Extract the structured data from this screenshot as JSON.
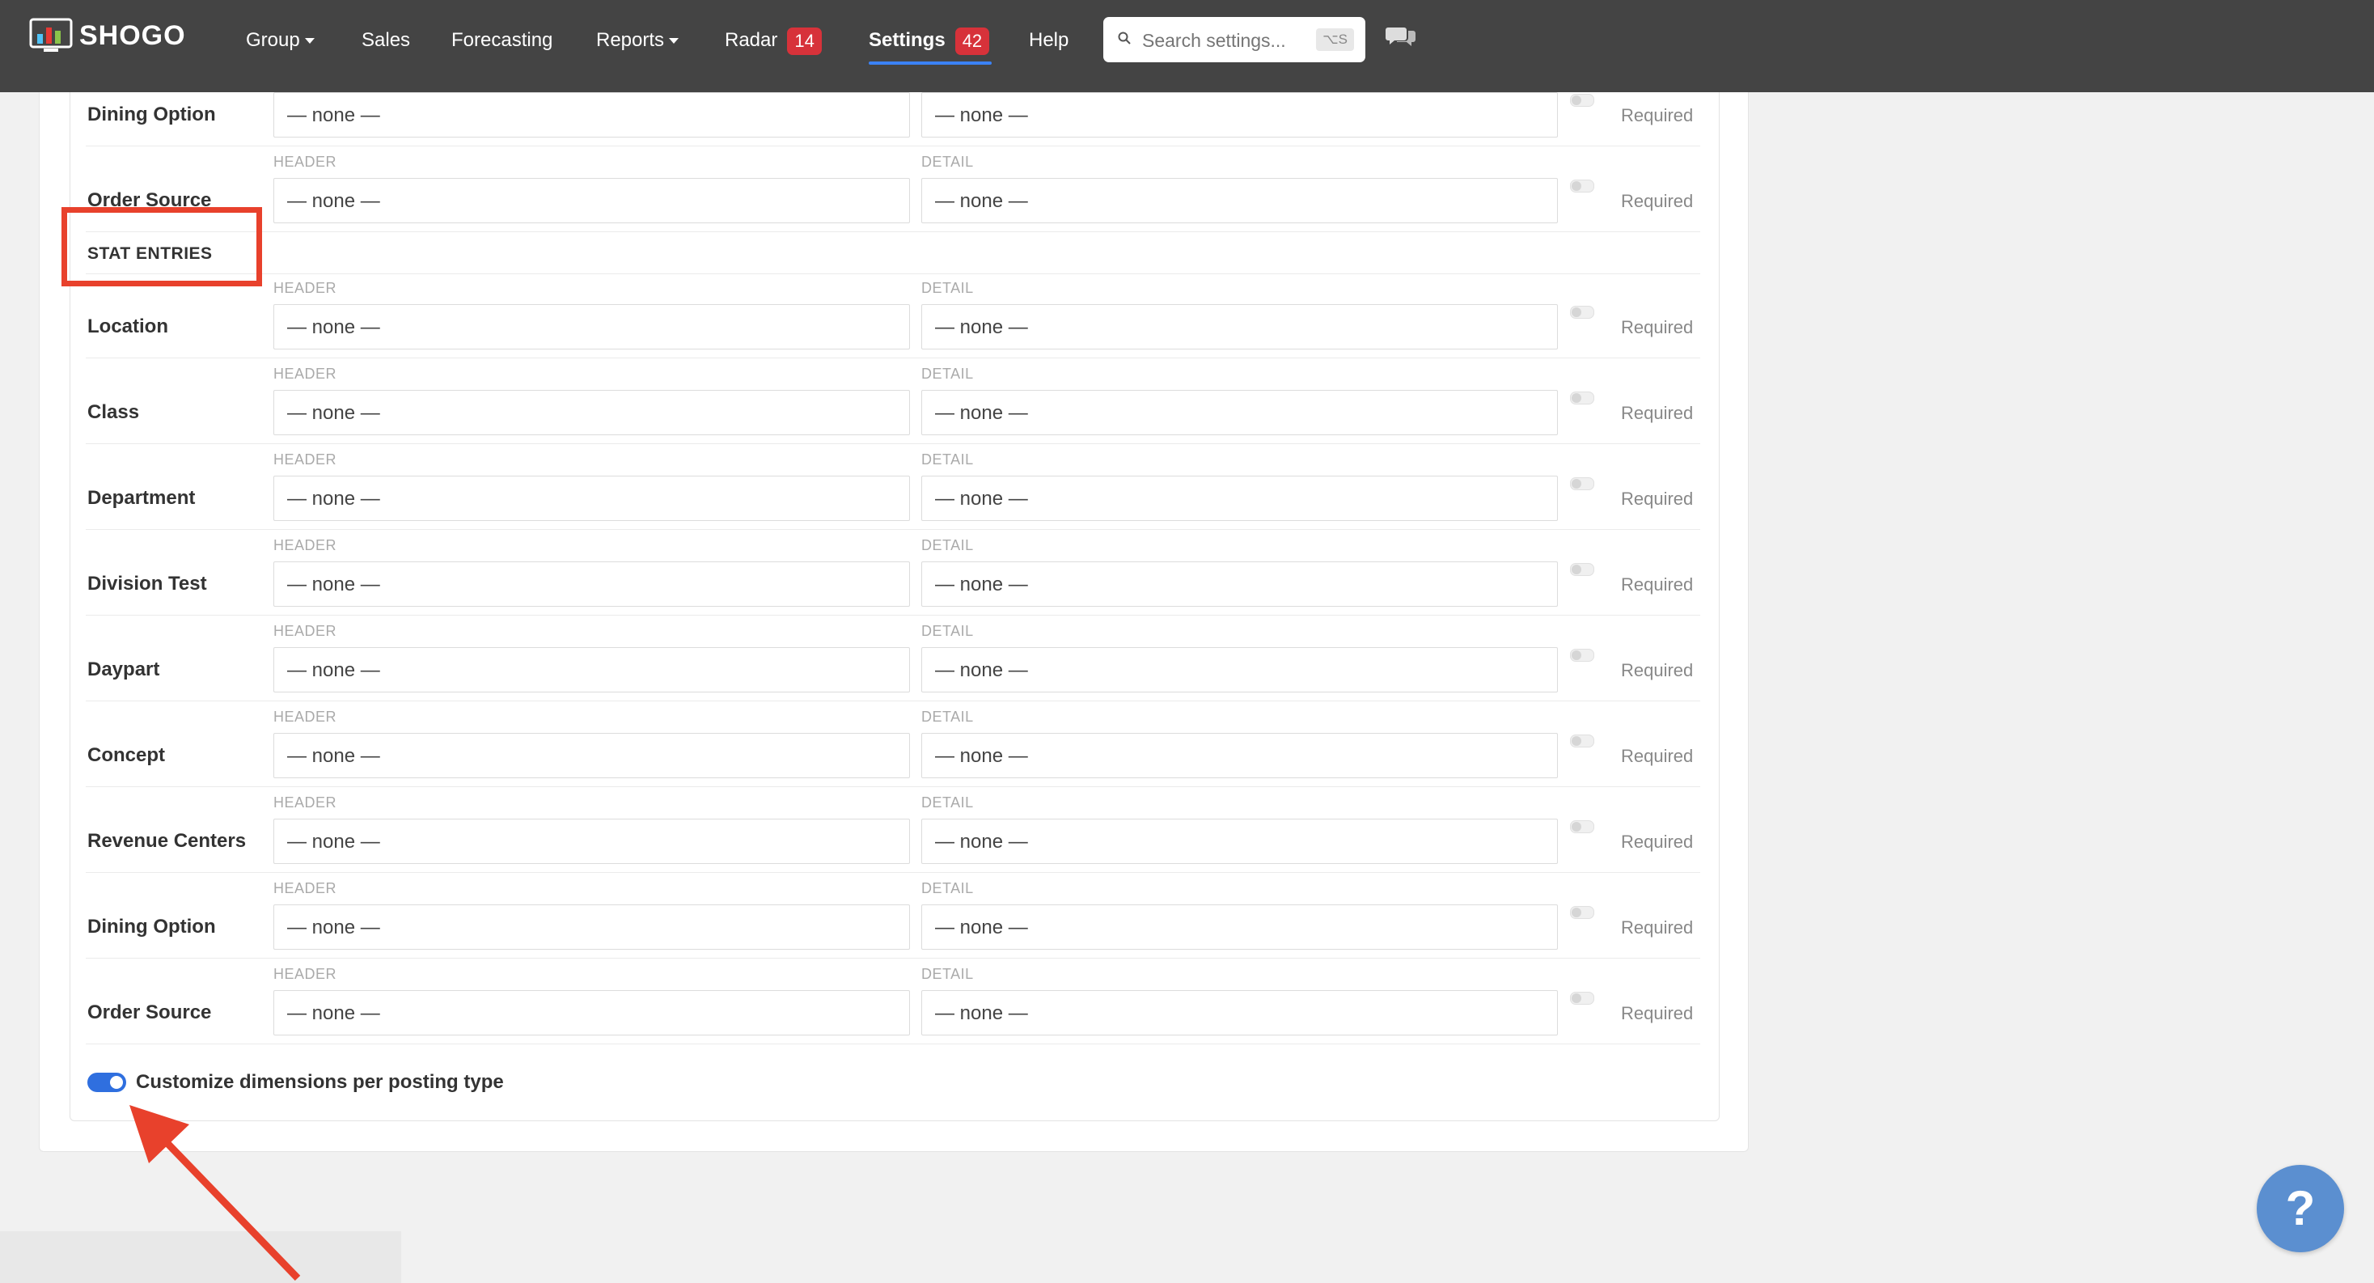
{
  "brand": {
    "name": "SHOGO",
    "accent": "#8bc34a"
  },
  "nav": {
    "group": "Group",
    "sales": "Sales",
    "forecasting": "Forecasting",
    "reports": "Reports",
    "radar": "Radar",
    "radar_badge": "14",
    "settings": "Settings",
    "settings_badge": "42",
    "help": "Help"
  },
  "search": {
    "placeholder": "Search settings...",
    "shortcut": "⌥S"
  },
  "columns": {
    "header": "HEADER",
    "detail": "DETAIL"
  },
  "none_value": "— none —",
  "required_label": "Required",
  "top_rows": [
    {
      "label": "Dining Option"
    },
    {
      "label": "Order Source"
    }
  ],
  "section": {
    "title": "STAT ENTRIES"
  },
  "stat_rows": [
    {
      "label": "Location"
    },
    {
      "label": "Class"
    },
    {
      "label": "Department"
    },
    {
      "label": "Division Test"
    },
    {
      "label": "Daypart"
    },
    {
      "label": "Concept"
    },
    {
      "label": "Revenue Centers"
    },
    {
      "label": "Dining Option"
    },
    {
      "label": "Order Source"
    }
  ],
  "customize": {
    "label": "Customize dimensions per posting type",
    "enabled": true
  },
  "help_button": "?",
  "colors": {
    "navbar": "#444444",
    "badge": "#d7323a",
    "toggle_on": "#2f6fdf",
    "annotation": "#e8412c",
    "help": "#5b8fd0"
  }
}
